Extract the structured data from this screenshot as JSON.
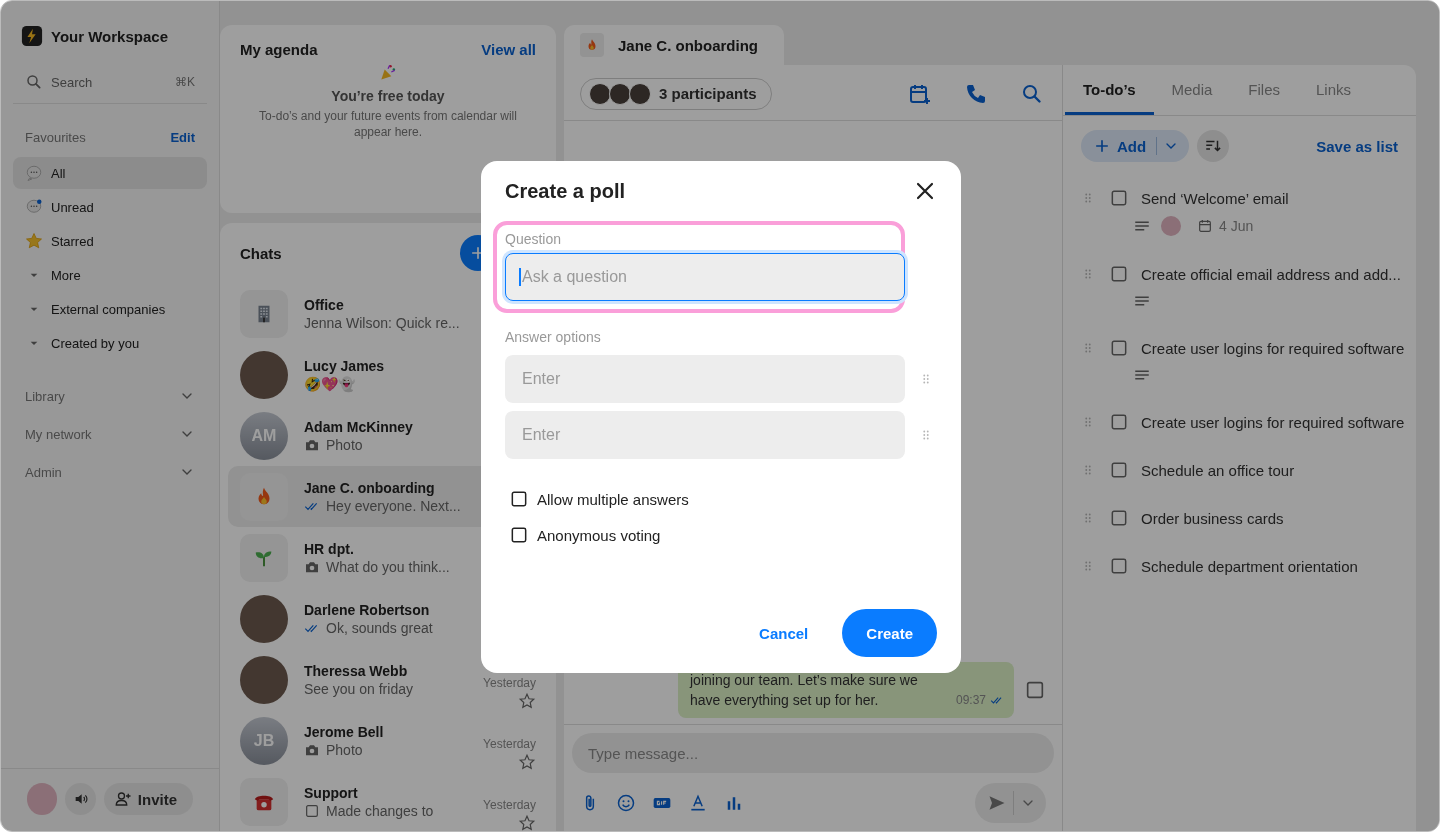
{
  "workspace": {
    "name": "Your Workspace"
  },
  "search": {
    "placeholder": "Search",
    "shortcut": "⌘K"
  },
  "favourites": {
    "title": "Favourites",
    "action": "Edit",
    "items": [
      {
        "label": "All",
        "kind": "chat",
        "selected": true
      },
      {
        "label": "Unread",
        "kind": "unread",
        "selected": false
      },
      {
        "label": "Starred",
        "kind": "star",
        "selected": false
      },
      {
        "label": "More",
        "kind": "group",
        "selected": false
      },
      {
        "label": "External companies",
        "kind": "group",
        "selected": false
      },
      {
        "label": "Created by you",
        "kind": "group",
        "selected": false
      }
    ]
  },
  "sections": [
    {
      "label": "Library"
    },
    {
      "label": "My network"
    },
    {
      "label": "Admin"
    }
  ],
  "footer": {
    "invite": "Invite"
  },
  "agenda": {
    "title": "My agenda",
    "action": "View all",
    "empty_title": "You’re free today",
    "empty_text": "To-do’s and your future events from calendar will appear here."
  },
  "chats": {
    "title": "Chats",
    "items": [
      {
        "name": "Office",
        "preview": {
          "kind": "text",
          "text": "Jenna Wilson:  Quick re..."
        },
        "avatar": {
          "kind": "building"
        },
        "selected": false
      },
      {
        "name": "Lucy James",
        "preview": {
          "kind": "text",
          "text": "🤣💖👻"
        },
        "avatar": {
          "kind": "photo"
        },
        "selected": false
      },
      {
        "name": "Adam McKinney",
        "preview": {
          "kind": "photo",
          "text": "Photo"
        },
        "avatar": {
          "kind": "initials",
          "initials": "AM"
        },
        "selected": false
      },
      {
        "name": "Jane C. onboarding",
        "preview": {
          "kind": "read",
          "text": "Hey everyone. Next..."
        },
        "avatar": {
          "kind": "fire"
        },
        "selected": true
      },
      {
        "name": "HR dpt.",
        "preview": {
          "kind": "photo",
          "text": "What do you think..."
        },
        "avatar": {
          "kind": "sprout"
        },
        "selected": false
      },
      {
        "name": "Darlene Robertson",
        "preview": {
          "kind": "read",
          "text": "Ok, sounds great"
        },
        "avatar": {
          "kind": "photo"
        },
        "selected": false
      },
      {
        "name": "Theressa Webb",
        "preview": {
          "kind": "text",
          "text": "See you on friday"
        },
        "avatar": {
          "kind": "photo"
        },
        "time": "Yesterday",
        "starred": false,
        "selected": false
      },
      {
        "name": "Jerome Bell",
        "preview": {
          "kind": "photo",
          "text": "Photo"
        },
        "avatar": {
          "kind": "initials",
          "initials": "JB"
        },
        "time": "Yesterday",
        "starred": false,
        "selected": false
      },
      {
        "name": "Support",
        "preview": {
          "kind": "task",
          "text": "Made changes to"
        },
        "avatar": {
          "kind": "phone"
        },
        "time": "Yesterday",
        "starred": false,
        "selected": false
      }
    ]
  },
  "conversation": {
    "title": "Jane C. onboarding",
    "participants": "3 participants",
    "message": {
      "text": "joining our team. Let’s make sure we have everything set up for her.",
      "time": "09:37"
    },
    "composer": {
      "placeholder": "Type message..."
    }
  },
  "panel": {
    "tabs": [
      {
        "label": "To-do’s",
        "selected": true
      },
      {
        "label": "Media",
        "selected": false
      },
      {
        "label": "Files",
        "selected": false
      },
      {
        "label": "Links",
        "selected": false
      }
    ],
    "add": "Add",
    "save": "Save as list",
    "todos": [
      {
        "title": "Send ‘Welcome’ email",
        "checked": false,
        "notes": true,
        "assignee": true,
        "date": "4 Jun"
      },
      {
        "title": "Create official email address and add...",
        "checked": false,
        "notes": true
      },
      {
        "title": "Create user logins for required software",
        "checked": false,
        "notes": true
      },
      {
        "title": "Create user logins for required software",
        "checked": false
      },
      {
        "title": "Schedule an office tour",
        "checked": false
      },
      {
        "title": "Order business cards",
        "checked": false
      },
      {
        "title": "Schedule department orientation",
        "checked": false
      }
    ]
  },
  "modal": {
    "title": "Create a poll",
    "question": {
      "label": "Question",
      "placeholder": "Ask a question",
      "focused": true
    },
    "answers": {
      "label": "Answer options",
      "options": [
        {
          "placeholder": "Enter"
        },
        {
          "placeholder": "Enter"
        }
      ]
    },
    "settings": [
      {
        "label": "Allow multiple answers",
        "checked": false
      },
      {
        "label": "Anonymous voting",
        "checked": false
      }
    ],
    "cancel": "Cancel",
    "create": "Create"
  }
}
